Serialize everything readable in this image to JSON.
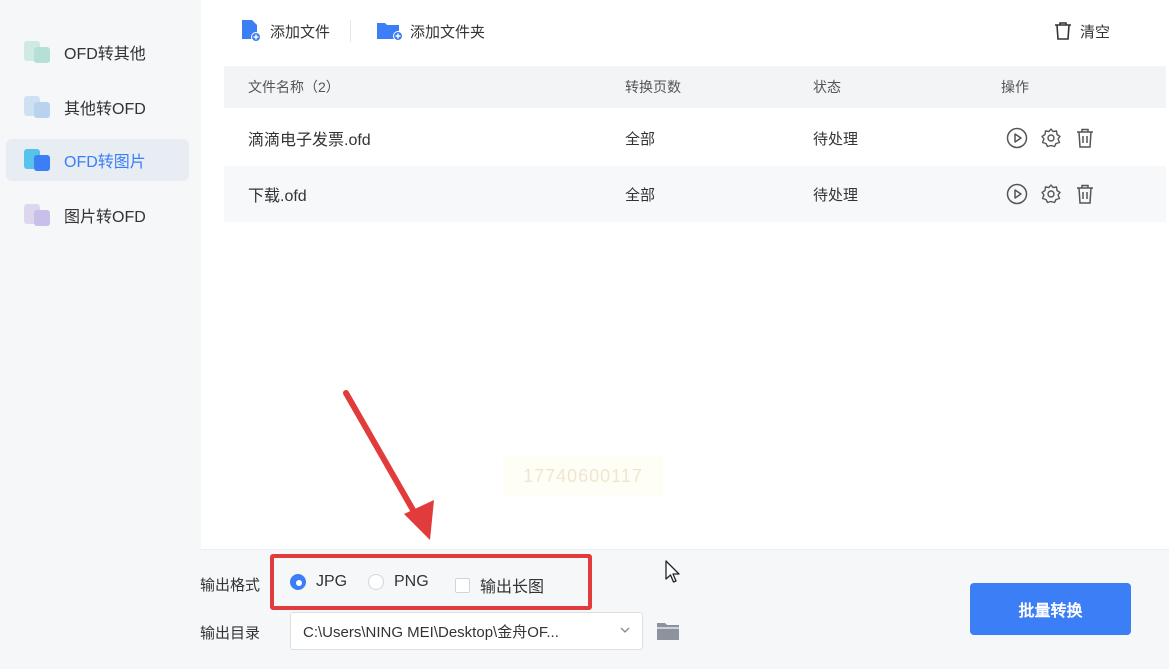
{
  "sidebar": {
    "items": [
      {
        "label": "OFD转其他",
        "active": false
      },
      {
        "label": "其他转OFD",
        "active": false
      },
      {
        "label": "OFD转图片",
        "active": true
      },
      {
        "label": "图片转OFD",
        "active": false
      }
    ]
  },
  "toolbar": {
    "add_file": "添加文件",
    "add_folder": "添加文件夹",
    "clear": "清空"
  },
  "table": {
    "headers": [
      "文件名称（2）",
      "转换页数",
      "状态",
      "操作"
    ],
    "rows": [
      {
        "name": "滴滴电子发票.ofd",
        "pages": "全部",
        "status": "待处理"
      },
      {
        "name": "下载.ofd",
        "pages": "全部",
        "status": "待处理"
      }
    ]
  },
  "watermark": "17740600117",
  "output": {
    "format_label": "输出格式",
    "formats": [
      {
        "label": "JPG",
        "selected": true
      },
      {
        "label": "PNG",
        "selected": false
      }
    ],
    "long_image_label": "输出长图",
    "long_image_checked": false,
    "dir_label": "输出目录",
    "dir_value": "C:\\Users\\NING MEI\\Desktop\\金舟OF..."
  },
  "convert_button": "批量转换",
  "colors": {
    "accent": "#3b7ef6",
    "annotation": "#e23b3b"
  }
}
